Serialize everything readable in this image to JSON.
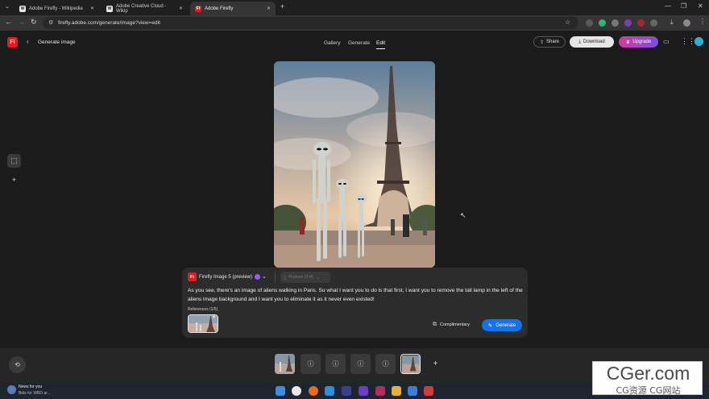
{
  "browser": {
    "tabs": [
      {
        "label": "Adobe Firefly - Wikipedia",
        "favicon": "W"
      },
      {
        "label": "Adobe Creative Cloud - Wikip",
        "favicon": "W"
      },
      {
        "label": "Adobe Firefly",
        "favicon": "Ff"
      }
    ],
    "url": "firefly.adobe.com/generate/image?view=edit"
  },
  "header": {
    "logo": "Fi",
    "title": "Generate image",
    "nav": [
      "Gallery",
      "Generate",
      "Edit"
    ],
    "share_label": "Share",
    "download_label": "Download",
    "upgrade_label": "Upgrade"
  },
  "panel": {
    "model_label": "Firefly Image 5 (preview)",
    "model_icon": "Fi",
    "aspect_label": "Portrait (3:4)",
    "prompt": "As you see, there's an image of aliens walking in Paris. So what I want you to do is that first, I want you to remove the tall lamp in the left of the aliens image background and I want you to eliminate it as it never even existed!",
    "references_label": "References (1/5)",
    "credits_label": "Complimentary",
    "generate_label": "Generate"
  },
  "taskbar": {
    "news_title": "News for you",
    "news_sub": "Bids for WBD ar..."
  },
  "watermark": {
    "main": "CGer.com",
    "sub": "CG资源 CG网站"
  },
  "colors": {
    "accent": "#1473e6",
    "upgrade": "#d6399f",
    "brand": "#e01b24"
  }
}
